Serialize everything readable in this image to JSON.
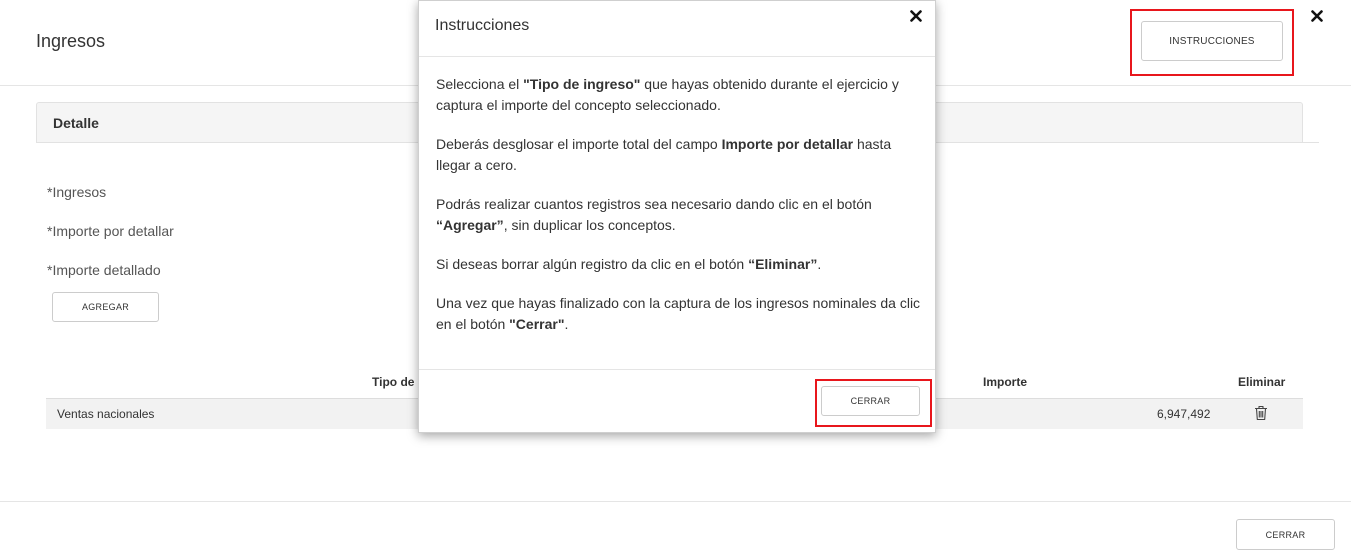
{
  "page": {
    "title": "Ingresos",
    "instructions_button": "INSTRUCCIONES",
    "close_icon": "close-x-icon",
    "detail_panel_title": "Detalle",
    "fields": {
      "ingresos_label": "*Ingresos",
      "importe_por_detallar_label": "*Importe por detallar",
      "importe_detallado_label": "*Importe detallado"
    },
    "add_button": "AGREGAR",
    "table": {
      "headers": {
        "tipo": "Tipo de",
        "importe": "Importe",
        "eliminar": "Eliminar"
      },
      "rows": [
        {
          "tipo": "Ventas nacionales",
          "importe": "6,947,492",
          "delete_icon": "trash-icon"
        }
      ]
    },
    "bottom_close_button": "CERRAR"
  },
  "modal": {
    "title": "Instrucciones",
    "close_icon": "close-x-icon",
    "paragraphs": [
      {
        "t1": "Selecciona el ",
        "b1": "\"Tipo de ingreso\"",
        "t2": " que hayas obtenido durante el ejercicio y captura el importe del concepto seleccionado."
      },
      {
        "t1": "Deberás desglosar el importe total del campo ",
        "b1": "Importe por detallar",
        "t2": " hasta llegar a cero."
      },
      {
        "t1": "Podrás realizar cuantos registros sea necesario dando clic en el botón ",
        "b1": "“Agregar”",
        "t2": ", sin duplicar los conceptos."
      },
      {
        "t1": "Si deseas borrar algún registro da clic en el botón ",
        "b1": "“Eliminar”",
        "t2": "."
      },
      {
        "t1": "Una vez que hayas finalizado con la captura de los ingresos nominales da clic en el botón ",
        "b1": "\"Cerrar\"",
        "t2": "."
      }
    ],
    "close_button": "CERRAR"
  },
  "colors": {
    "highlight": "#e8161c",
    "row_background": "#f2f2f2",
    "panel_header": "#f5f5f5"
  }
}
